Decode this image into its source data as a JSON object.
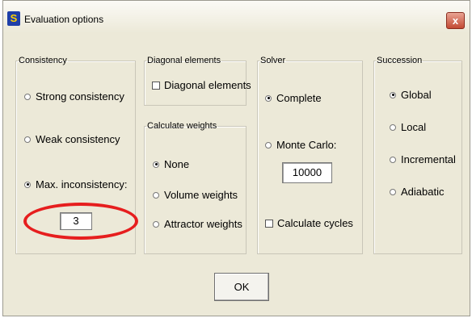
{
  "window": {
    "title": "Evaluation options",
    "close_label": "x",
    "app_icon": "S"
  },
  "groups": {
    "consistency": {
      "legend": "Consistency",
      "options": [
        "Strong consistency",
        "Weak consistency",
        "Max. inconsistency:"
      ],
      "selected": "Max. inconsistency:",
      "max_value": "3"
    },
    "diagonal": {
      "legend": "Diagonal elements",
      "checkbox_label": "Diagonal elements",
      "checked": false
    },
    "weights": {
      "legend": "Calculate weights",
      "options": [
        "None",
        "Volume weights",
        "Attractor weights"
      ],
      "selected": "None"
    },
    "solver": {
      "legend": "Solver",
      "options": [
        "Complete",
        "Monte Carlo:"
      ],
      "selected": "Complete",
      "monte_carlo_value": "10000",
      "cycles_label": "Calculate cycles",
      "cycles_checked": false
    },
    "succession": {
      "legend": "Succession",
      "options": [
        "Global",
        "Local",
        "Incremental",
        "Adiabatic"
      ],
      "selected": "Global"
    }
  },
  "ok_label": "OK",
  "annotation_color": "#e61e1e"
}
